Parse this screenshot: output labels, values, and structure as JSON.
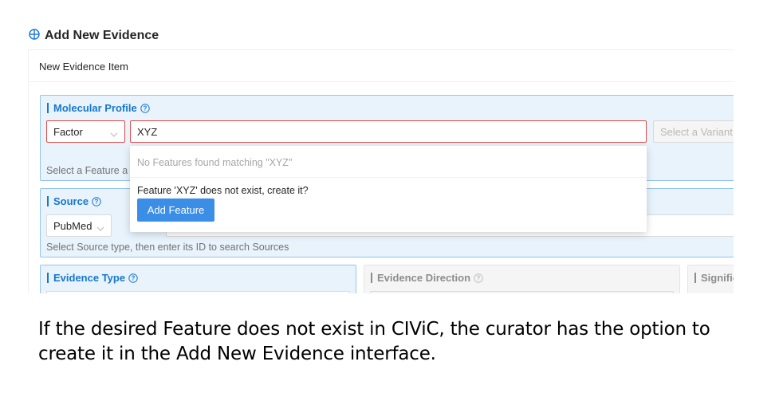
{
  "header": {
    "title": "Add New Evidence",
    "icon": "plus-circle-icon"
  },
  "card": {
    "title": "New Evidence Item"
  },
  "molecular_profile": {
    "title": "Molecular Profile",
    "type_select": "Factor",
    "feature_input_value": "XYZ",
    "variant_placeholder": "Select a Variant",
    "help_text": "Select a Feature a"
  },
  "dropdown": {
    "empty_text": "No Features found matching \"XYZ\"",
    "create_message": "Feature 'XYZ' does not exist, create it?",
    "button_label": "Add Feature"
  },
  "source": {
    "title": "Source",
    "type_select": "PubMed",
    "help_text": "Select Source type, then enter its ID to search Sources"
  },
  "evidence_type": {
    "title": "Evidence Type"
  },
  "evidence_direction": {
    "title": "Evidence Direction"
  },
  "significance": {
    "title": "Signific"
  },
  "caption": "If the desired Feature does not exist in CIViC, the curator has the option to create it in the Add New Evidence interface.",
  "colors": {
    "accent": "#1677d0",
    "button": "#3a8ee6",
    "error": "#e34a4a",
    "section_bg": "#e8f3fc"
  }
}
